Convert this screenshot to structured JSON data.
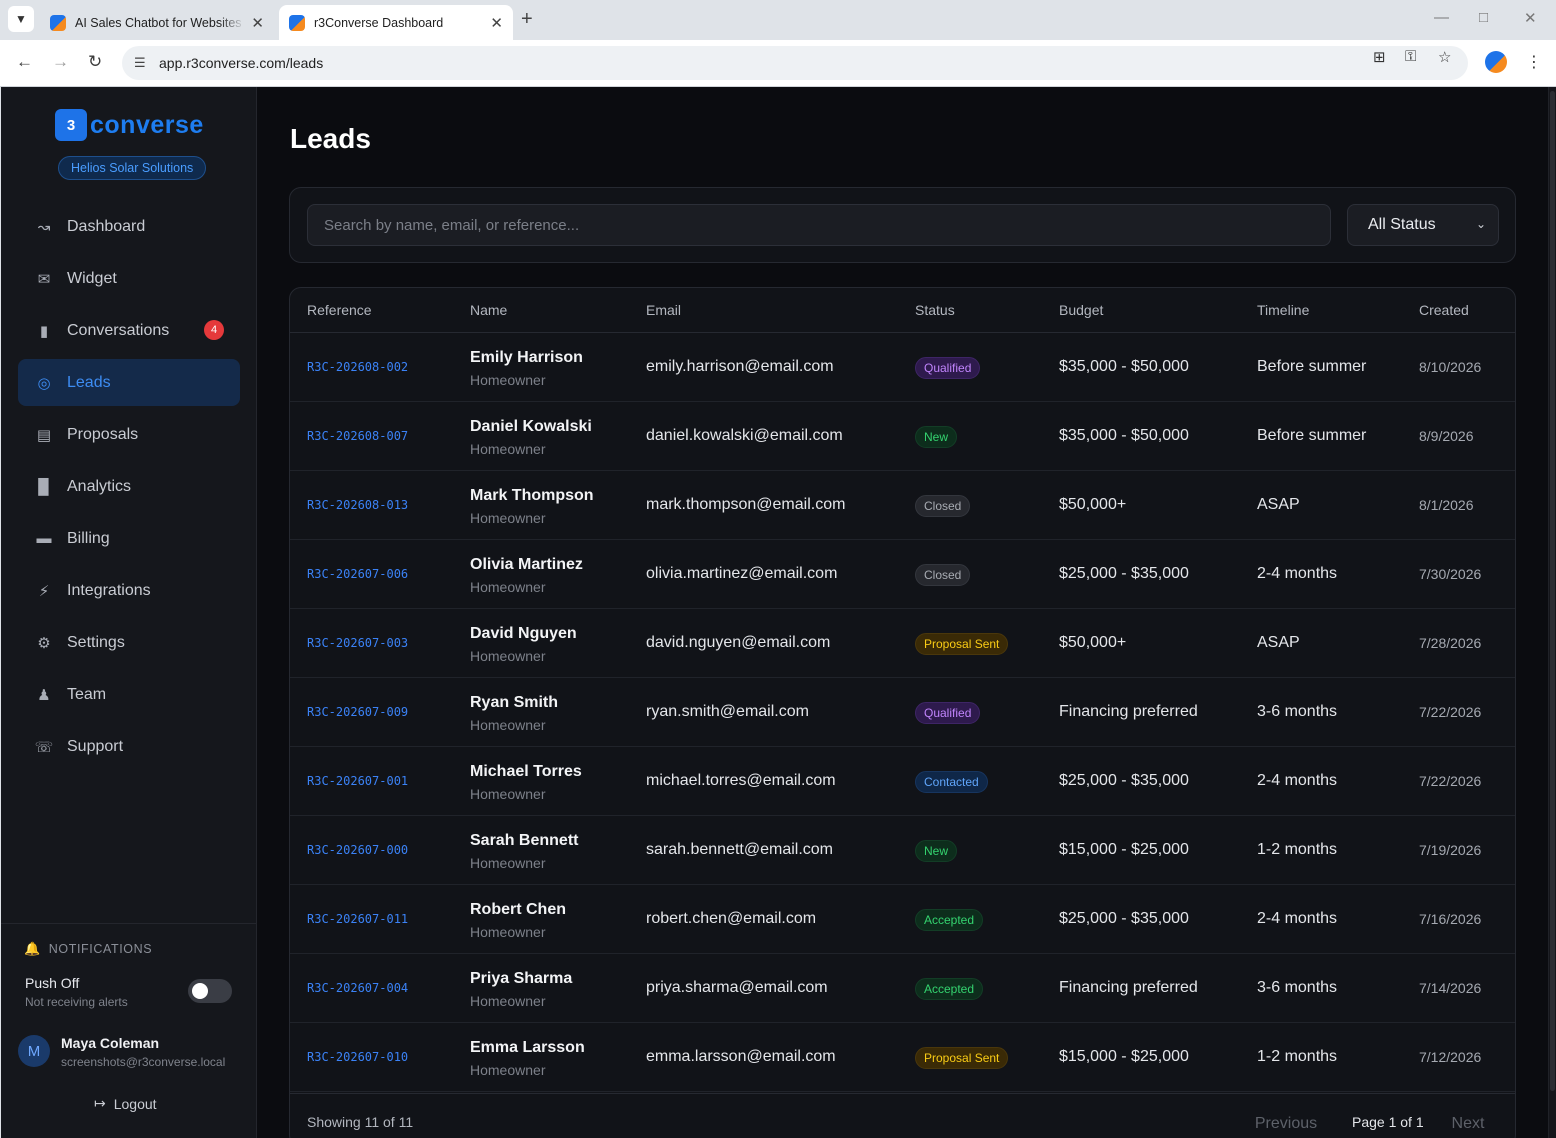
{
  "browser": {
    "tabs": [
      {
        "title": "AI Sales Chatbot for Websites –",
        "active": false
      },
      {
        "title": "r3Converse Dashboard",
        "active": true
      }
    ],
    "url": "app.r3converse.com/leads"
  },
  "sidebar": {
    "logo_text": "converse",
    "logo_mark": "3",
    "org_name": "Helios Solar Solutions",
    "items": [
      {
        "label": "Dashboard",
        "icon": "chart-line-icon"
      },
      {
        "label": "Widget",
        "icon": "chat-bubbles-icon"
      },
      {
        "label": "Conversations",
        "icon": "message-icon",
        "badge": "4"
      },
      {
        "label": "Leads",
        "icon": "target-icon",
        "active": true
      },
      {
        "label": "Proposals",
        "icon": "document-icon"
      },
      {
        "label": "Analytics",
        "icon": "bar-chart-icon"
      },
      {
        "label": "Billing",
        "icon": "credit-card-icon"
      },
      {
        "label": "Integrations",
        "icon": "plug-icon"
      },
      {
        "label": "Settings",
        "icon": "gear-icon"
      },
      {
        "label": "Team",
        "icon": "users-icon"
      },
      {
        "label": "Support",
        "icon": "headset-icon"
      }
    ],
    "notifications": {
      "heading": "NOTIFICATIONS",
      "push_title": "Push Off",
      "push_subtitle": "Not receiving alerts",
      "enabled": false
    },
    "user": {
      "initial": "M",
      "name": "Maya Coleman",
      "email": "screenshots@r3converse.local"
    },
    "logout_label": "Logout"
  },
  "main": {
    "title": "Leads",
    "search": {
      "placeholder": "Search by name, email, or reference...",
      "value": ""
    },
    "status_filter": "All Status",
    "columns": [
      "Reference",
      "Name",
      "Email",
      "Status",
      "Budget",
      "Timeline",
      "Created"
    ],
    "rows": [
      {
        "reference": "R3C-202608-002",
        "name": "Emily Harrison",
        "role": "Homeowner",
        "email": "emily.harrison@email.com",
        "status": "Qualified",
        "budget": "$35,000 - $50,000",
        "timeline": "Before summer",
        "created": "8/10/2026"
      },
      {
        "reference": "R3C-202608-007",
        "name": "Daniel Kowalski",
        "role": "Homeowner",
        "email": "daniel.kowalski@email.com",
        "status": "New",
        "budget": "$35,000 - $50,000",
        "timeline": "Before summer",
        "created": "8/9/2026"
      },
      {
        "reference": "R3C-202608-013",
        "name": "Mark Thompson",
        "role": "Homeowner",
        "email": "mark.thompson@email.com",
        "status": "Closed",
        "budget": "$50,000+",
        "timeline": "ASAP",
        "created": "8/1/2026"
      },
      {
        "reference": "R3C-202607-006",
        "name": "Olivia Martinez",
        "role": "Homeowner",
        "email": "olivia.martinez@email.com",
        "status": "Closed",
        "budget": "$25,000 - $35,000",
        "timeline": "2-4 months",
        "created": "7/30/2026"
      },
      {
        "reference": "R3C-202607-003",
        "name": "David Nguyen",
        "role": "Homeowner",
        "email": "david.nguyen@email.com",
        "status": "Proposal Sent",
        "budget": "$50,000+",
        "timeline": "ASAP",
        "created": "7/28/2026"
      },
      {
        "reference": "R3C-202607-009",
        "name": "Ryan Smith",
        "role": "Homeowner",
        "email": "ryan.smith@email.com",
        "status": "Qualified",
        "budget": "Financing preferred",
        "timeline": "3-6 months",
        "created": "7/22/2026"
      },
      {
        "reference": "R3C-202607-001",
        "name": "Michael Torres",
        "role": "Homeowner",
        "email": "michael.torres@email.com",
        "status": "Contacted",
        "budget": "$25,000 - $35,000",
        "timeline": "2-4 months",
        "created": "7/22/2026"
      },
      {
        "reference": "R3C-202607-000",
        "name": "Sarah Bennett",
        "role": "Homeowner",
        "email": "sarah.bennett@email.com",
        "status": "New",
        "budget": "$15,000 - $25,000",
        "timeline": "1-2 months",
        "created": "7/19/2026"
      },
      {
        "reference": "R3C-202607-011",
        "name": "Robert Chen",
        "role": "Homeowner",
        "email": "robert.chen@email.com",
        "status": "Accepted",
        "budget": "$25,000 - $35,000",
        "timeline": "2-4 months",
        "created": "7/16/2026"
      },
      {
        "reference": "R3C-202607-004",
        "name": "Priya Sharma",
        "role": "Homeowner",
        "email": "priya.sharma@email.com",
        "status": "Accepted",
        "budget": "Financing preferred",
        "timeline": "3-6 months",
        "created": "7/14/2026"
      },
      {
        "reference": "R3C-202607-010",
        "name": "Emma Larsson",
        "role": "Homeowner",
        "email": "emma.larsson@email.com",
        "status": "Proposal Sent",
        "budget": "$15,000 - $25,000",
        "timeline": "1-2 months",
        "created": "7/12/2026"
      }
    ],
    "footer": {
      "showing": "Showing 11 of 11",
      "previous": "Previous",
      "page": "Page 1 of 1",
      "next": "Next"
    }
  },
  "colors": {
    "accent": "#3b82f6",
    "sidebar_bg": "#15171c",
    "main_bg": "#0b0c10",
    "badge_red": "#e5393b"
  }
}
